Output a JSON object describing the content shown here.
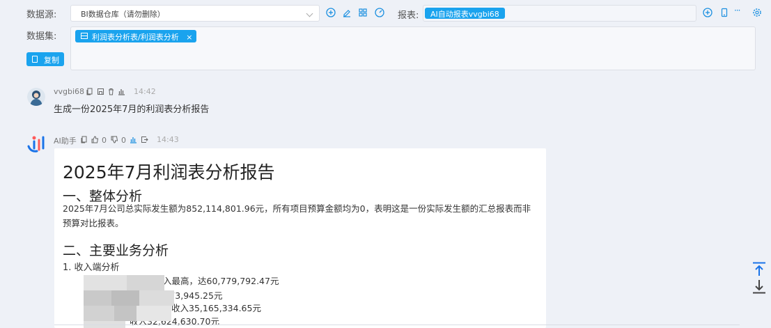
{
  "toolbar": {
    "datasource_label": "数据源:",
    "datasource_value": "BI数据仓库（请勿删除）",
    "report_label": "报表:",
    "report_tag": "AI自动报表vvgbi68",
    "dataset_label": "数据集:",
    "dataset_tag": "利润表分析表/利润表分析",
    "copy_label": "复制",
    "more_icon": "···"
  },
  "messages": [
    {
      "author": "vvgbi68",
      "time": "14:42",
      "text": "生成一份2025年7月的利润表分析报告"
    },
    {
      "author": "AI助手",
      "time": "14:43",
      "likes": "0",
      "dislikes": "0"
    }
  ],
  "report": {
    "title": "2025年7月利润表分析报告",
    "section1_title": "一、整体分析",
    "section1_text": "2025年7月公司总实际发生额为852,114,801.96元，所有项目预算金额均为0，表明这是一份实际发生额的汇总报表而非预算对比报表。",
    "section2_title": "二、主要业务分析",
    "sub1_title": "1. 收入端分析",
    "lines": [
      "入最高，达60,779,792.47元",
      "入41,573,945.25元",
      "收入35,165,334.65元",
      "收入32,624,630.70元"
    ]
  },
  "colors": {
    "accent": "#1aa3ee",
    "background": "#eef1f7"
  }
}
